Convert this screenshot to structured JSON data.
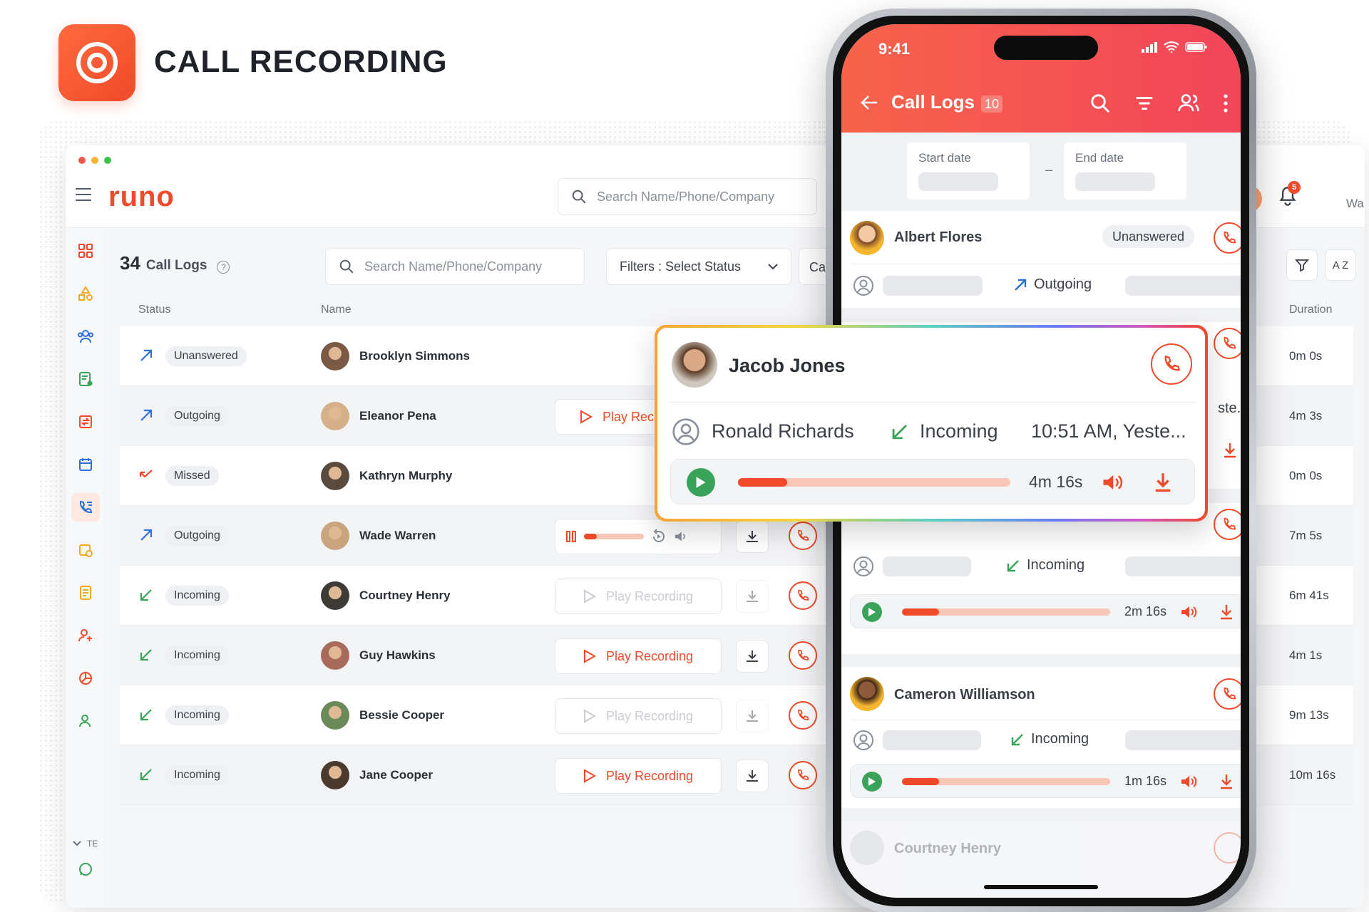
{
  "hero": {
    "title": "CALL RECORDING"
  },
  "desktop": {
    "logo_text": "runo",
    "top_search_placeholder": "Search Name/Phone/Company",
    "notification_count": "5",
    "header_partial_text": "Wa",
    "page_count": "34",
    "page_label": "Call Logs",
    "inner_search_placeholder": "Search Name/Phone/Company",
    "filter_label": "Filters : Select Status",
    "filter2_partial": "Ca",
    "sort_label": "A Z",
    "sidebar_section_label": "TE",
    "columns": {
      "status": "Status",
      "name": "Name",
      "duration": "Duration"
    },
    "play_label": "Play Recording",
    "play_label_partial": "Play Rec",
    "rows": [
      {
        "direction": "outgoing",
        "status": "Unanswered",
        "name": "Brooklyn Simmons",
        "duration": "0m 0s",
        "recording": "none"
      },
      {
        "direction": "outgoing",
        "status": "Outgoing",
        "name": "Eleanor Pena",
        "duration": "4m 3s",
        "recording": "partial"
      },
      {
        "direction": "missed",
        "status": "Missed",
        "name": "Kathryn Murphy",
        "duration": "0m 0s",
        "recording": "none"
      },
      {
        "direction": "outgoing",
        "status": "Outgoing",
        "name": "Wade Warren",
        "duration": "7m 5s",
        "recording": "playing"
      },
      {
        "direction": "incoming",
        "status": "Incoming",
        "name": "Courtney Henry",
        "duration": "6m 41s",
        "recording": "disabled"
      },
      {
        "direction": "incoming",
        "status": "Incoming",
        "name": "Guy Hawkins",
        "duration": "4m 1s",
        "recording": "enabled"
      },
      {
        "direction": "incoming",
        "status": "Incoming",
        "name": "Bessie Cooper",
        "duration": "9m 13s",
        "recording": "disabled"
      },
      {
        "direction": "incoming",
        "status": "Incoming",
        "name": "Jane Cooper",
        "duration": "10m 16s",
        "recording": "enabled"
      }
    ]
  },
  "phone": {
    "time": "9:41",
    "title": "Call Logs",
    "badge": "10",
    "start_date_label": "Start date",
    "end_date_label": "End date",
    "date_separator": "–",
    "cards": [
      {
        "name": "Albert Flores",
        "pill": "Unanswered",
        "direction": "Outgoing"
      },
      {
        "partial_text": "ste..."
      },
      {
        "direction": "Incoming",
        "duration": "2m 16s"
      },
      {
        "name": "Cameron Williamson",
        "direction": "Incoming",
        "duration": "1m 16s"
      },
      {
        "name": "Courtney Henry"
      }
    ]
  },
  "popup": {
    "name": "Jacob Jones",
    "agent": "Ronald Richards",
    "direction": "Incoming",
    "time": "10:51 AM, Yeste...",
    "duration": "4m 16s",
    "progress_fraction": 0.18
  },
  "colors": {
    "accent": "#f04a2a",
    "incoming": "#3aa35a",
    "outgoing": "#2f6fdb",
    "missed": "#f04a2a"
  }
}
